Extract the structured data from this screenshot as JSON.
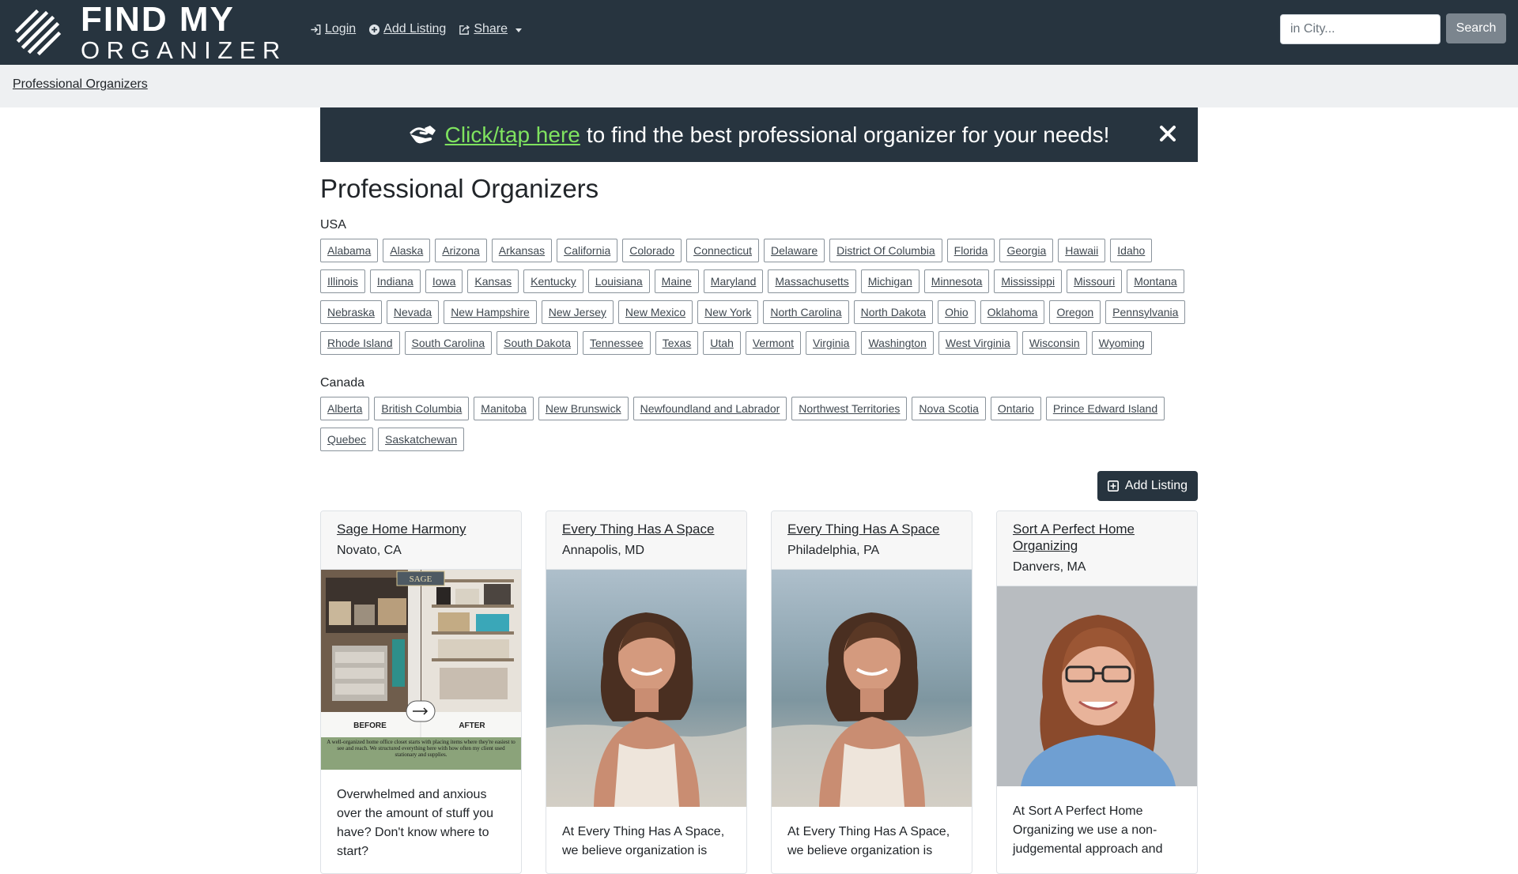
{
  "brand": {
    "line1": "FIND MY",
    "line2": "ORGANIZER"
  },
  "nav": {
    "login": "Login",
    "add_listing": "Add Listing",
    "share": "Share"
  },
  "search": {
    "placeholder": "in City...",
    "button": "Search"
  },
  "breadcrumb": "Professional Organizers",
  "banner": {
    "link_text": "Click/tap here",
    "text": "to find the best professional organizer for your needs!",
    "link_color": "#7fe35f"
  },
  "page_title": "Professional Organizers",
  "regions": [
    {
      "label": "USA",
      "items": [
        "Alabama",
        "Alaska",
        "Arizona",
        "Arkansas",
        "California",
        "Colorado",
        "Connecticut",
        "Delaware",
        "District Of Columbia",
        "Florida",
        "Georgia",
        "Hawaii",
        "Idaho",
        "Illinois",
        "Indiana",
        "Iowa",
        "Kansas",
        "Kentucky",
        "Louisiana",
        "Maine",
        "Maryland",
        "Massachusetts",
        "Michigan",
        "Minnesota",
        "Mississippi",
        "Missouri",
        "Montana",
        "Nebraska",
        "Nevada",
        "New Hampshire",
        "New Jersey",
        "New Mexico",
        "New York",
        "North Carolina",
        "North Dakota",
        "Ohio",
        "Oklahoma",
        "Oregon",
        "Pennsylvania",
        "Rhode Island",
        "South Carolina",
        "South Dakota",
        "Tennessee",
        "Texas",
        "Utah",
        "Vermont",
        "Virginia",
        "Washington",
        "West Virginia",
        "Wisconsin",
        "Wyoming"
      ]
    },
    {
      "label": "Canada",
      "items": [
        "Alberta",
        "British Columbia",
        "Manitoba",
        "New Brunswick",
        "Newfoundland and Labrador",
        "Northwest Territories",
        "Nova Scotia",
        "Ontario",
        "Prince Edward Island",
        "Quebec",
        "Saskatchewan"
      ]
    }
  ],
  "add_listing_button": "Add Listing",
  "listings": [
    {
      "name": "Sage Home Harmony",
      "location": "Novato, CA",
      "image": "before-after-closet",
      "image_labels": {
        "logo": "SAGE",
        "before": "BEFORE",
        "after": "AFTER",
        "caption": "A well-organized home office closet starts with placing items where they're easiest to see and reach. We structured everything here with how often my client used stationary and supplies."
      },
      "excerpt": "Overwhelmed and anxious over the amount of stuff you have? Don't know where to start?"
    },
    {
      "name": "Every Thing Has A Space",
      "location": "Annapolis, MD",
      "image": "portrait-beach",
      "excerpt": "At Every Thing Has A Space, we believe organization is"
    },
    {
      "name": "Every Thing Has A Space",
      "location": "Philadelphia, PA",
      "image": "portrait-beach",
      "excerpt": "At Every Thing Has A Space, we believe organization is"
    },
    {
      "name": "Sort A Perfect Home Organizing",
      "location": "Danvers, MA",
      "image": "portrait-studio",
      "excerpt": "At Sort A Perfect Home Organizing we use a non-judgemental approach and"
    }
  ],
  "colors": {
    "navbar": "#27343f",
    "breadcrumb_bg": "#eef0f2",
    "search_button": "#7b858e"
  }
}
